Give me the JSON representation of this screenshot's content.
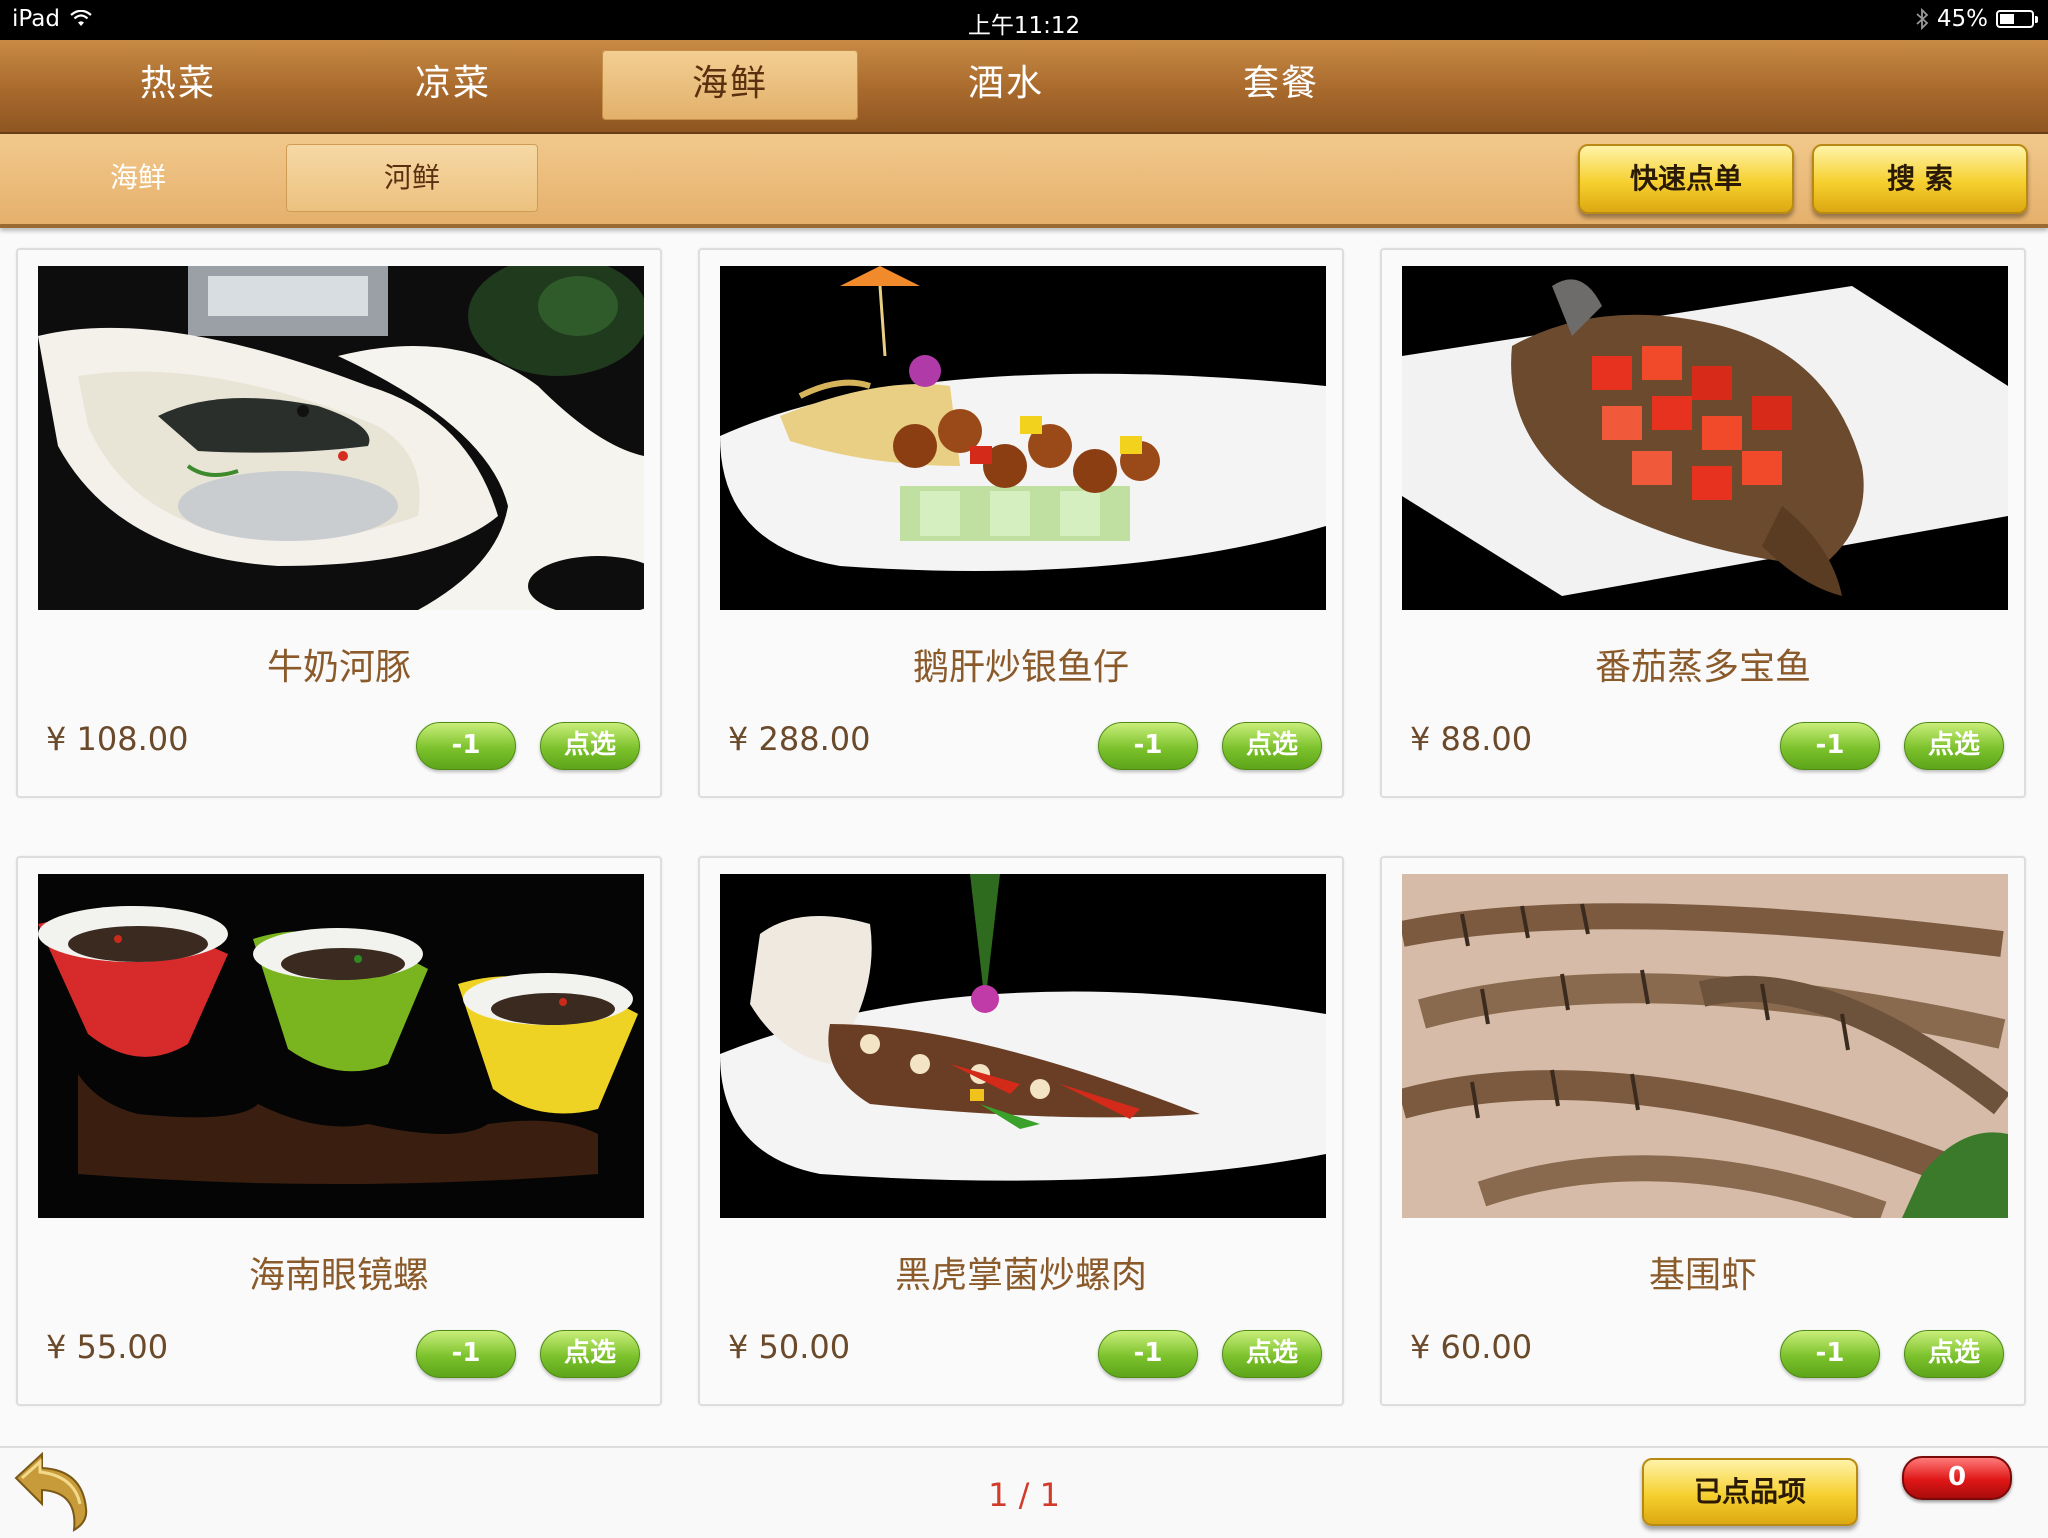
{
  "status_bar": {
    "device": "iPad",
    "time": "上午11:12",
    "battery": "45%",
    "battery_level": 0.45
  },
  "main_tabs": [
    {
      "label": "热菜"
    },
    {
      "label": "凉菜"
    },
    {
      "label": "海鲜",
      "active": true
    },
    {
      "label": "酒水"
    },
    {
      "label": "套餐"
    }
  ],
  "sub_tabs": [
    {
      "label": "海鲜"
    },
    {
      "label": "河鲜",
      "active": true
    }
  ],
  "actions": {
    "quick_order": "快速点单",
    "search": "搜 索"
  },
  "currency": "¥",
  "button_labels": {
    "minus": "-1",
    "pick": "点选"
  },
  "dishes": [
    {
      "name": "牛奶河豚",
      "price": "108.00",
      "image": "milk-pufferfish-soup"
    },
    {
      "name": "鹅肝炒银鱼仔",
      "price": "288.00",
      "image": "foie-gras-silverfish"
    },
    {
      "name": "番茄蒸多宝鱼",
      "price": "88.00",
      "image": "tomato-steamed-turbot"
    },
    {
      "name": "海南眼镜螺",
      "price": "55.00",
      "image": "hainan-snails-in-bowls"
    },
    {
      "name": "黑虎掌菌炒螺肉",
      "price": "50.00",
      "image": "mushroom-conch-stirfry"
    },
    {
      "name": "基围虾",
      "price": "60.00",
      "image": "raw-shrimp-on-ice"
    }
  ],
  "footer": {
    "page": "1 / 1",
    "ordered_button": "已点品项",
    "ordered_count": "0"
  },
  "colors": {
    "accent_brown": "#a8692c",
    "price_green": "#7cc22c",
    "badge_red": "#e01616",
    "pager_red": "#d23a2a"
  }
}
